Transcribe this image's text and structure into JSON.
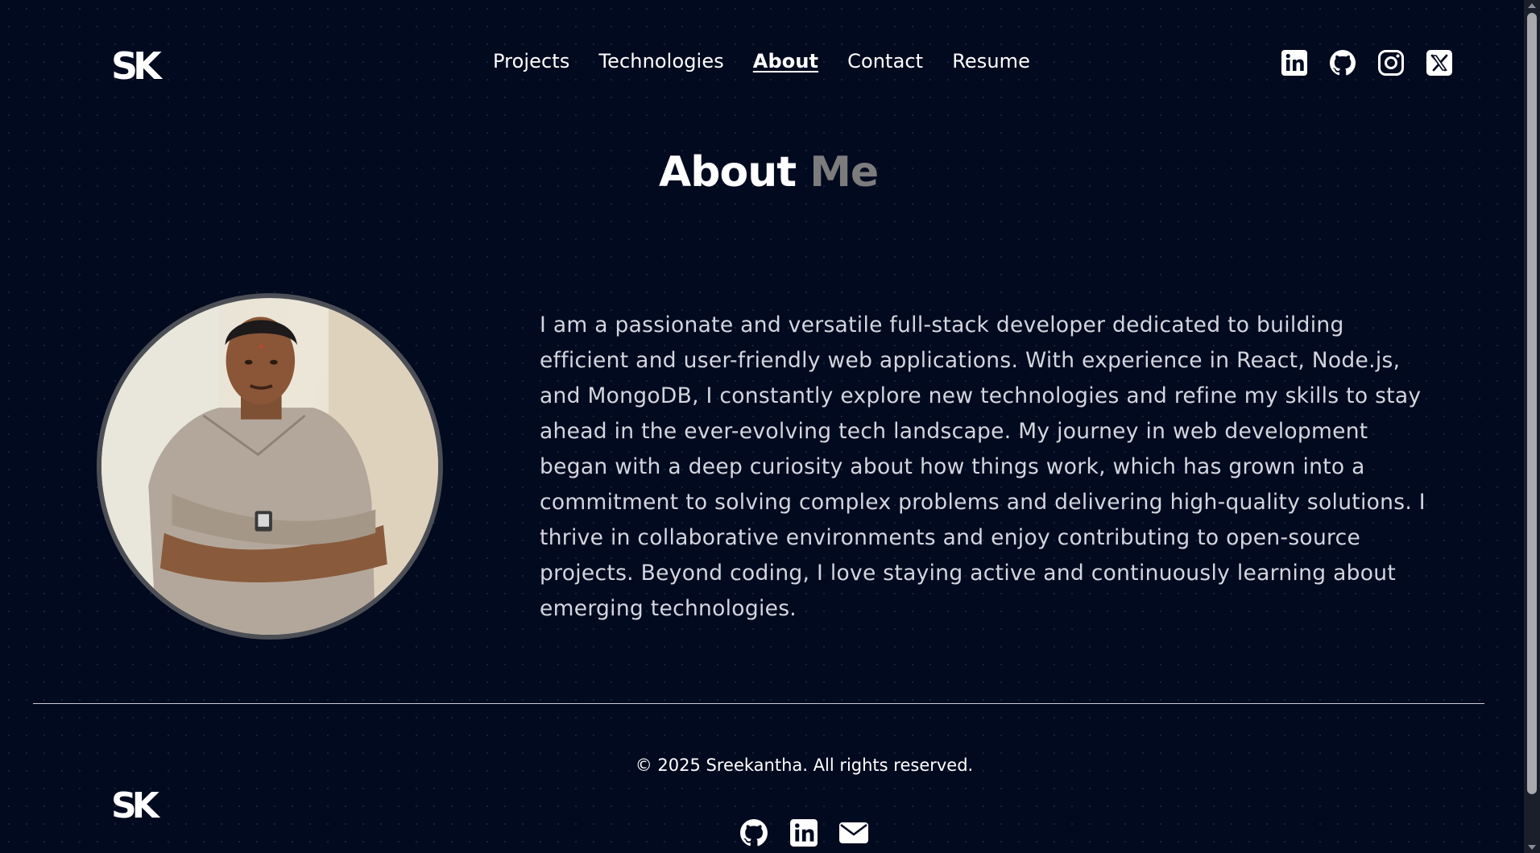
{
  "brand": {
    "logo_text": "SK"
  },
  "nav": {
    "links": [
      {
        "label": "Projects",
        "active": false
      },
      {
        "label": "Technologies",
        "active": false
      },
      {
        "label": "About",
        "active": true
      },
      {
        "label": "Contact",
        "active": false
      },
      {
        "label": "Resume",
        "active": false
      }
    ]
  },
  "social_top": [
    "linkedin-icon",
    "github-icon",
    "instagram-icon",
    "x-icon"
  ],
  "about": {
    "heading_first": "About",
    "heading_second": "Me",
    "bio": "I am a passionate and versatile full-stack developer dedicated to building efficient and user-friendly web applications. With experience in React, Node.js, and MongoDB, I constantly explore new technologies and refine my skills to stay ahead in the ever-evolving tech landscape. My journey in web development began with a deep curiosity about how things work, which has grown into a commitment to solving complex problems and delivering high-quality solutions. I thrive in collaborative environments and enjoy contributing to open-source projects. Beyond coding, I love staying active and continuously learning about emerging technologies."
  },
  "footer": {
    "copyright": "© 2025 Sreekantha. All rights reserved.",
    "social": [
      "github-icon",
      "linkedin-icon",
      "mail-icon"
    ]
  },
  "colors": {
    "background": "#020a1f",
    "heading_accent": "#7c7c7c",
    "body_text": "#d3d6de"
  }
}
